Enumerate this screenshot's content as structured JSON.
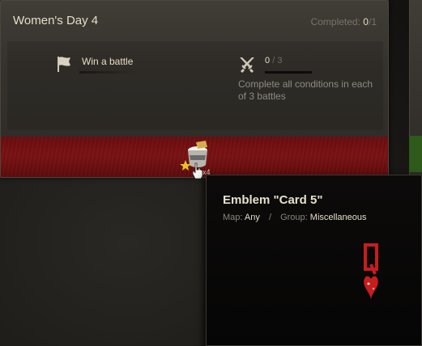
{
  "quest": {
    "title": "Women's Day 4",
    "completed_label": "Completed:",
    "completed_done": "0",
    "completed_total": "/1"
  },
  "conditions": {
    "main": {
      "icon": "flag-icon",
      "label": "Win a battle"
    },
    "battles": {
      "icon": "crossed-swords-icon",
      "current": "0",
      "separator": "/",
      "total": "3",
      "progress": 0,
      "description": "Complete all conditions in each of 3 battles"
    }
  },
  "reward": {
    "icon": "emblem-bucket-icon",
    "count": "x4"
  },
  "tooltip": {
    "title": "Emblem \"Card 5\"",
    "map_label": "Map:",
    "map_value": "Any",
    "separator": "/",
    "group_label": "Group:",
    "group_value": "Miscellaneous",
    "emblem_icon": "queen-of-hearts-emblem-icon"
  },
  "colors": {
    "reward_band": "#7a1214",
    "title_text": "#e6ddc6",
    "muted_text": "#8a857b",
    "adjacent_card_band": "#2f5a1c"
  }
}
